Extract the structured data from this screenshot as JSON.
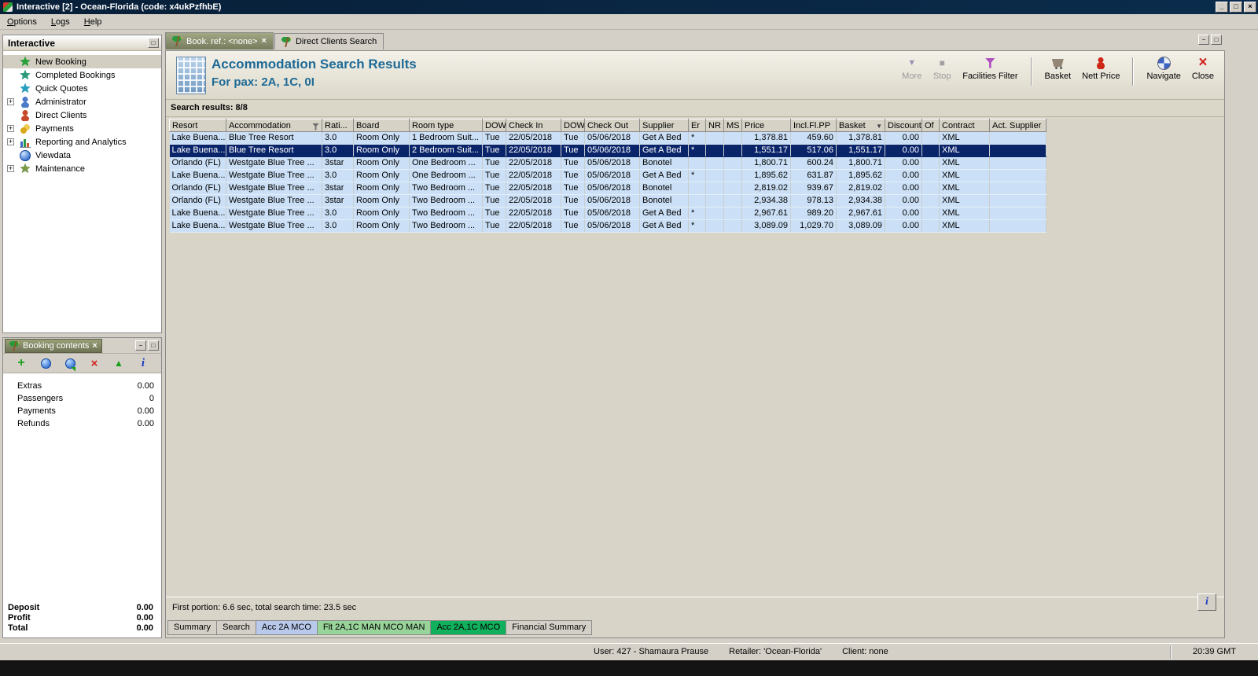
{
  "window": {
    "title": "Interactive [2] - Ocean-Florida (code: x4ukPzfhbE)",
    "minimize_glyph": "_",
    "maximize_glyph": "□",
    "close_glyph": "×"
  },
  "panel_controls": {
    "minimize": "−",
    "restore": "□",
    "close": "×"
  },
  "menubar": {
    "items": [
      "Options",
      "Logs",
      "Help"
    ]
  },
  "sidebar": {
    "title": "Interactive",
    "items": [
      {
        "label": "New Booking",
        "icon": "starburst-green-icon",
        "selected": true
      },
      {
        "label": "Completed Bookings",
        "icon": "starburst-teal-icon"
      },
      {
        "label": "Quick Quotes",
        "icon": "starburst-cyan-icon"
      },
      {
        "label": "Administrator",
        "icon": "person-blue-icon",
        "expandable": true
      },
      {
        "label": "Direct Clients",
        "icon": "person-red-icon"
      },
      {
        "label": "Payments",
        "icon": "coins-icon",
        "expandable": true
      },
      {
        "label": "Reporting and Analytics",
        "icon": "chart-icon",
        "expandable": true
      },
      {
        "label": "Viewdata",
        "icon": "globe-icon"
      },
      {
        "label": "Maintenance",
        "icon": "starburst-olive-icon",
        "expandable": true
      }
    ]
  },
  "booking_contents": {
    "title": "Booking contents",
    "toolbar": [
      {
        "icon": "add-icon",
        "glyph": "+"
      },
      {
        "icon": "internet-icon",
        "glyph": ""
      },
      {
        "icon": "internet-export-icon",
        "glyph": ""
      },
      {
        "icon": "delete-icon",
        "glyph": "×"
      },
      {
        "icon": "move-up-icon",
        "glyph": "▲"
      },
      {
        "icon": "info-icon",
        "glyph": "i"
      }
    ],
    "rows": [
      {
        "label": "Extras",
        "value": "0.00"
      },
      {
        "label": "Passengers",
        "value": "0"
      },
      {
        "label": "Payments",
        "value": "0.00"
      },
      {
        "label": "Refunds",
        "value": "0.00"
      }
    ],
    "totals": [
      {
        "label": "Deposit",
        "value": "0.00"
      },
      {
        "label": "Profit",
        "value": "0.00"
      },
      {
        "label": "Total",
        "value": "0.00"
      }
    ]
  },
  "main": {
    "tabs": [
      {
        "label": "Book. ref.: <none>",
        "icon": "palm-icon",
        "active": true,
        "closable": true
      },
      {
        "label": "Direct Clients Search",
        "icon": "palm-icon"
      }
    ],
    "header": {
      "title": "Accommodation Search Results",
      "subtitle": "For pax: 2A, 1C, 0I"
    },
    "toolbar": [
      {
        "label": "More",
        "icon": "more-icon",
        "disabled": true
      },
      {
        "label": "Stop",
        "icon": "stop-icon",
        "disabled": true
      },
      {
        "label": "Facilities Filter",
        "icon": "filter-icon"
      },
      {
        "sep": true
      },
      {
        "label": "Basket",
        "icon": "basket-icon"
      },
      {
        "label": "Nett Price",
        "icon": "nett-price-icon"
      },
      {
        "sep": true
      },
      {
        "label": "Navigate",
        "icon": "navigate-icon"
      },
      {
        "label": "Close",
        "icon": "close-red-icon"
      }
    ],
    "results_label": "Search results: 8/8",
    "table": {
      "columns": [
        {
          "label": "Resort"
        },
        {
          "label": "Accommodation",
          "icon": "filter-icon"
        },
        {
          "label": "Rati..."
        },
        {
          "label": "Board"
        },
        {
          "label": "Room type"
        },
        {
          "label": "DOW"
        },
        {
          "label": "Check In"
        },
        {
          "label": "DOW"
        },
        {
          "label": "Check Out"
        },
        {
          "label": "Supplier"
        },
        {
          "label": "Er"
        },
        {
          "label": "NR"
        },
        {
          "label": "MS"
        },
        {
          "label": "Price"
        },
        {
          "label": "Incl.Fl.PP"
        },
        {
          "label": "Basket",
          "icon": "sort-icon",
          "sort_glyph": "▼"
        },
        {
          "label": "Discount"
        },
        {
          "label": "Of"
        },
        {
          "label": "Contract"
        },
        {
          "label": "Act. Supplier"
        }
      ],
      "rows": [
        [
          "Lake Buena...",
          "Blue Tree Resort",
          "3.0",
          "Room Only",
          "1 Bedroom Suit...",
          "Tue",
          "22/05/2018",
          "Tue",
          "05/06/2018",
          "Get A Bed",
          "*",
          "",
          "",
          "1,378.81",
          "459.60",
          "1,378.81",
          "0.00",
          "",
          "XML",
          ""
        ],
        [
          "Lake Buena...",
          "Blue Tree Resort",
          "3.0",
          "Room Only",
          "2 Bedroom Suit...",
          "Tue",
          "22/05/2018",
          "Tue",
          "05/06/2018",
          "Get A Bed",
          "*",
          "",
          "",
          "1,551.17",
          "517.06",
          "1,551.17",
          "0.00",
          "",
          "XML",
          ""
        ],
        [
          "Orlando (FL)",
          "Westgate Blue Tree ...",
          "3star",
          "Room Only",
          "One Bedroom ...",
          "Tue",
          "22/05/2018",
          "Tue",
          "05/06/2018",
          "Bonotel",
          "",
          "",
          "",
          "1,800.71",
          "600.24",
          "1,800.71",
          "0.00",
          "",
          "XML",
          ""
        ],
        [
          "Lake Buena...",
          "Westgate Blue Tree ...",
          "3.0",
          "Room Only",
          "One Bedroom ...",
          "Tue",
          "22/05/2018",
          "Tue",
          "05/06/2018",
          "Get A Bed",
          "*",
          "",
          "",
          "1,895.62",
          "631.87",
          "1,895.62",
          "0.00",
          "",
          "XML",
          ""
        ],
        [
          "Orlando (FL)",
          "Westgate Blue Tree ...",
          "3star",
          "Room Only",
          "Two Bedroom ...",
          "Tue",
          "22/05/2018",
          "Tue",
          "05/06/2018",
          "Bonotel",
          "",
          "",
          "",
          "2,819.02",
          "939.67",
          "2,819.02",
          "0.00",
          "",
          "XML",
          ""
        ],
        [
          "Orlando (FL)",
          "Westgate Blue Tree ...",
          "3star",
          "Room Only",
          "Two Bedroom ...",
          "Tue",
          "22/05/2018",
          "Tue",
          "05/06/2018",
          "Bonotel",
          "",
          "",
          "",
          "2,934.38",
          "978.13",
          "2,934.38",
          "0.00",
          "",
          "XML",
          ""
        ],
        [
          "Lake Buena...",
          "Westgate Blue Tree ...",
          "3.0",
          "Room Only",
          "Two Bedroom ...",
          "Tue",
          "22/05/2018",
          "Tue",
          "05/06/2018",
          "Get A Bed",
          "*",
          "",
          "",
          "2,967.61",
          "989.20",
          "2,967.61",
          "0.00",
          "",
          "XML",
          ""
        ],
        [
          "Lake Buena...",
          "Westgate Blue Tree ...",
          "3.0",
          "Room Only",
          "Two Bedroom ...",
          "Tue",
          "22/05/2018",
          "Tue",
          "05/06/2018",
          "Get A Bed",
          "*",
          "",
          "",
          "3,089.09",
          "1,029.70",
          "3,089.09",
          "0.00",
          "",
          "XML",
          ""
        ]
      ],
      "selected_row_index": 1
    },
    "status_line": "First portion: 6.6 sec, total search time: 23.5 sec",
    "info_glyph": "i",
    "bottom_tabs": [
      {
        "label": "Summary"
      },
      {
        "label": "Search"
      },
      {
        "label": "Acc 2A MCO",
        "color": "blue"
      },
      {
        "label": "Flt 2A,1C MAN MCO MAN",
        "color": "lightgreen"
      },
      {
        "label": "Acc 2A,1C MCO",
        "color": "green",
        "active": true
      },
      {
        "label": "Financial Summary"
      }
    ]
  },
  "statusbar": {
    "user": "User: 427 - Shamaura Prause",
    "retailer": "Retailer: 'Ocean-Florida'",
    "client": "Client: none",
    "time": "20:39 GMT"
  },
  "colors": {
    "selected_row": "#0a246a",
    "row": "#cbe0f6",
    "tab_green": "#10b05c",
    "tab_light_green": "#98d49a",
    "tab_blue": "#b9c9ec",
    "header_title": "#1e6a96"
  }
}
